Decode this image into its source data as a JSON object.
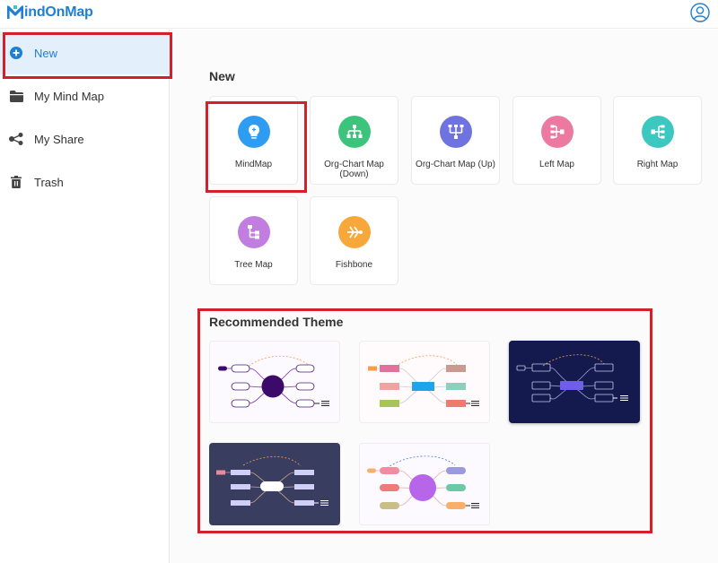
{
  "app": {
    "logo_text": "indOnMap",
    "logo_letter": "M"
  },
  "sidebar": {
    "items": [
      {
        "label": "New",
        "icon": "plus-circle-icon",
        "active": true
      },
      {
        "label": "My Mind Map",
        "icon": "folder-icon"
      },
      {
        "label": "My Share",
        "icon": "share-icon"
      },
      {
        "label": "Trash",
        "icon": "trash-icon"
      }
    ]
  },
  "main": {
    "new_title": "New",
    "templates": [
      {
        "label": "MindMap",
        "icon": "lightbulb-head-icon",
        "color": "#2e9cf0"
      },
      {
        "label": "Org-Chart Map (Down)",
        "icon": "org-chart-down-icon",
        "color": "#3cc47c"
      },
      {
        "label": "Org-Chart Map (Up)",
        "icon": "org-chart-up-icon",
        "color": "#6f73e0"
      },
      {
        "label": "Left Map",
        "icon": "left-map-icon",
        "color": "#ec7aa0"
      },
      {
        "label": "Right Map",
        "icon": "right-map-icon",
        "color": "#3cc8c0"
      },
      {
        "label": "Tree Map",
        "icon": "tree-map-icon",
        "color": "#c27de0"
      },
      {
        "label": "Fishbone",
        "icon": "fishbone-icon",
        "color": "#f8a83a"
      }
    ],
    "recommended_title": "Recommended Theme",
    "themes": [
      {
        "name": "theme-purple-light",
        "bg": "#fdfaff",
        "center": "#3c0a6b"
      },
      {
        "name": "theme-colorful-light",
        "bg": "#fffafb",
        "center": "#1aa6e8"
      },
      {
        "name": "theme-dark-navy",
        "bg": "#141a4e",
        "center": "#6f5ee8"
      },
      {
        "name": "theme-slate",
        "bg": "#393d60",
        "center": "#ffffff"
      },
      {
        "name": "theme-pastel",
        "bg": "#fdfaff",
        "center": "#b766ea"
      }
    ]
  },
  "colors": {
    "accent": "#1e7fd4",
    "highlight": "#d42029",
    "active_bg": "#e3effa"
  }
}
